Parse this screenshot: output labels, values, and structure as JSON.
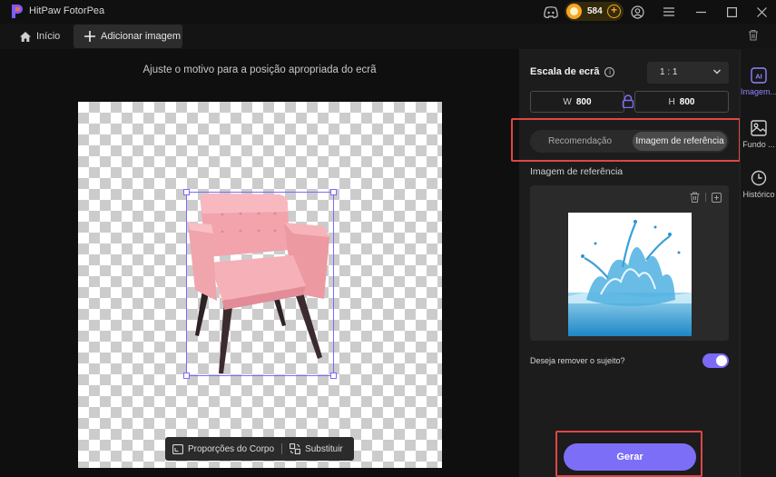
{
  "app": {
    "title": "HitPaw FotorPea",
    "credits": "584"
  },
  "toolbar": {
    "home_label": "Início",
    "add_image_label": "Adicionar imagem"
  },
  "canvas": {
    "hint": "Ajuste o motivo para a posição apropriada do ecrã",
    "body_proportions_label": "Proporções do Corpo",
    "replace_label": "Substituir"
  },
  "panel": {
    "scale_label": "Escala de ecrã",
    "ratio_value": "1 : 1",
    "width_prefix": "W",
    "width_value": "800",
    "height_prefix": "H",
    "height_value": "800",
    "mode_options": [
      "Recomendação",
      "Imagem de referência"
    ],
    "active_mode": "Imagem de referência",
    "reference_title": "Imagem de referência",
    "remove_subject_label": "Deseja remover o sujeito?",
    "remove_subject_enabled": true,
    "generate_label": "Gerar"
  },
  "rail": {
    "items": [
      {
        "label": "Imagem...",
        "icon": "ai-image-icon",
        "active": true
      },
      {
        "label": "Fundo ...",
        "icon": "background-icon",
        "active": false
      },
      {
        "label": "Histórico",
        "icon": "history-icon",
        "active": false
      }
    ]
  },
  "colors": {
    "accent": "#7d6ef7",
    "highlight_outline": "#e04646",
    "credits_coin": "#f5a623"
  }
}
